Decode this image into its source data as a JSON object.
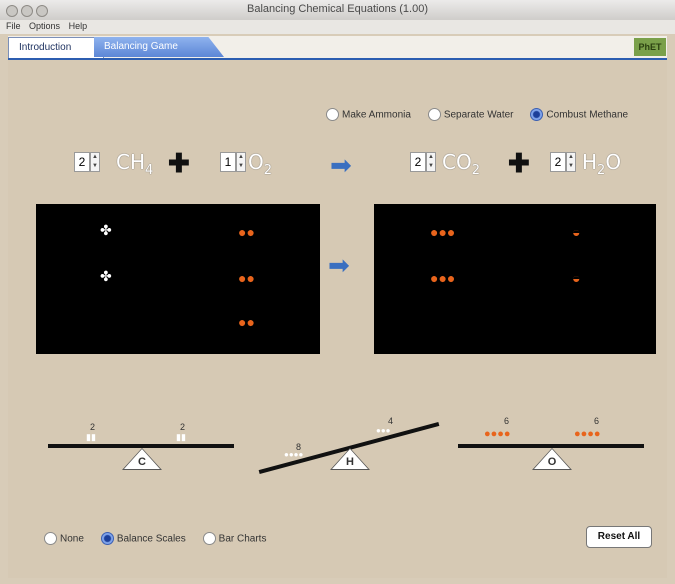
{
  "window": {
    "title": "Balancing Chemical Equations (1.00)"
  },
  "menu": {
    "items": [
      "File",
      "Options",
      "Help"
    ]
  },
  "tabs": [
    {
      "label": "Introduction"
    },
    {
      "label": "Balancing Game"
    }
  ],
  "logo": {
    "label": "PhET"
  },
  "reactions": {
    "options": [
      "Make Ammonia",
      "Separate Water",
      "Combust Methane"
    ],
    "selected": "Combust Methane"
  },
  "equation": {
    "reactants": [
      {
        "coef": "2",
        "formula": "CH",
        "sub": "4",
        "after": ""
      },
      {
        "coef": "1",
        "formula": "O",
        "sub": "2",
        "after": ""
      }
    ],
    "products": [
      {
        "coef": "2",
        "formula": "CO",
        "sub": "2",
        "after": ""
      },
      {
        "coef": "2",
        "formula": "H",
        "sub": "2",
        "after": "O"
      }
    ],
    "plus": "✚",
    "arrow": "➡"
  },
  "scales": [
    {
      "element": "C",
      "left": "2",
      "right": "2"
    },
    {
      "element": "H",
      "left": "8",
      "right": "4"
    },
    {
      "element": "O",
      "left": "6",
      "right": "6"
    }
  ],
  "tools": {
    "options": [
      "None",
      "Balance Scales",
      "Bar Charts"
    ],
    "selected": "Balance Scales",
    "reset_label": "Reset All"
  },
  "colors": {
    "accent": "#2c5db0",
    "oxygen": "#e8641c",
    "carbon": "#ffffff"
  }
}
